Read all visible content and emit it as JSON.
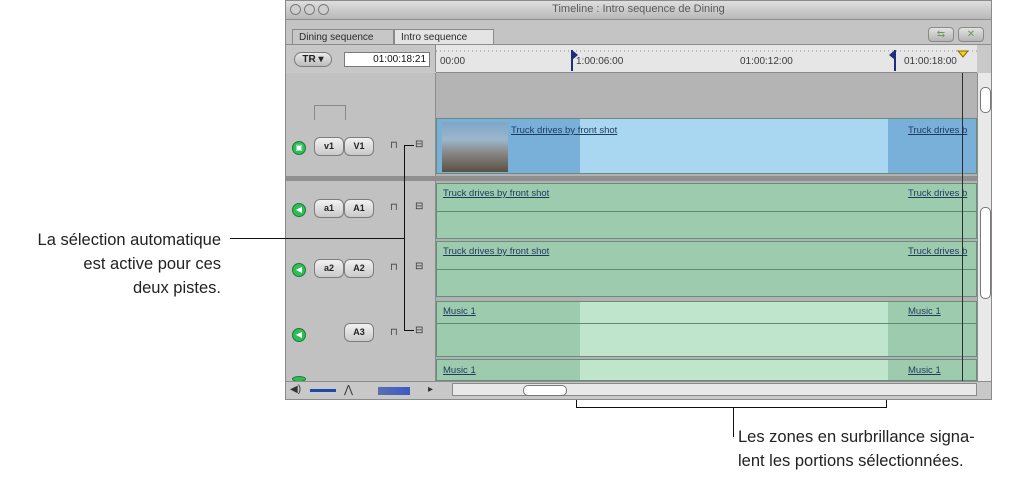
{
  "window": {
    "title": "Timeline : Intro sequence de Dining"
  },
  "tabs": [
    {
      "label": "Dining sequence"
    },
    {
      "label": "Intro sequence"
    }
  ],
  "toolbar": {
    "tr_label": "TR",
    "timecode": "01:00:18:21",
    "snap_glyph": "⇆",
    "link_glyph": "✕"
  },
  "ruler": {
    "labels": [
      "00:00",
      "1:00:06:00",
      "01:00:12:00",
      "01:00:18:00"
    ]
  },
  "tracks": {
    "v1": {
      "source": "v1",
      "dest": "V1",
      "clip_in": "Truck drives by front shot",
      "clip_out": "Truck drives b"
    },
    "a1": {
      "source": "a1",
      "dest": "A1",
      "clip_in": "Truck drives by front shot",
      "clip_out": "Truck drives b"
    },
    "a2": {
      "source": "a2",
      "dest": "A2",
      "clip_in": "Truck drives by front shot",
      "clip_out": "Truck drives b"
    },
    "a3": {
      "dest": "A3",
      "clip_in": "Music 1",
      "clip_out": "Music 1"
    },
    "a4": {
      "clip_in": "Music 1",
      "clip_out": "Music 1"
    }
  },
  "callouts": {
    "left_line1": "La sélection automatique",
    "left_line2": "est active pour ces",
    "left_line3": "deux pistes.",
    "bottom_line1": "Les zones en surbrillance signa-",
    "bottom_line2": "lent les portions sélectionnées."
  },
  "colors": {
    "video": "#a9d7f1",
    "audio": "#bfe5cd",
    "selected_video": "#79b0da",
    "selected_audio": "#9ccbae"
  }
}
